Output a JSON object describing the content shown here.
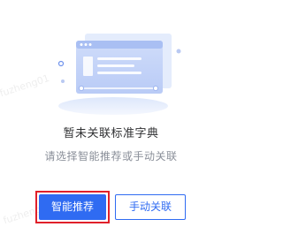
{
  "empty_state": {
    "title": "暂未关联标准字典",
    "subtitle": "请选择智能推荐或手动关联",
    "illustration_icon": "document-window-icon"
  },
  "actions": {
    "smart_recommend_label": "智能推荐",
    "manual_link_label": "手动关联"
  },
  "watermark": {
    "text": "fuzheng01"
  },
  "colors": {
    "primary": "#2f6bf2",
    "highlight": "#e0202a",
    "title": "#303133",
    "subtitle": "#8a8f99"
  }
}
